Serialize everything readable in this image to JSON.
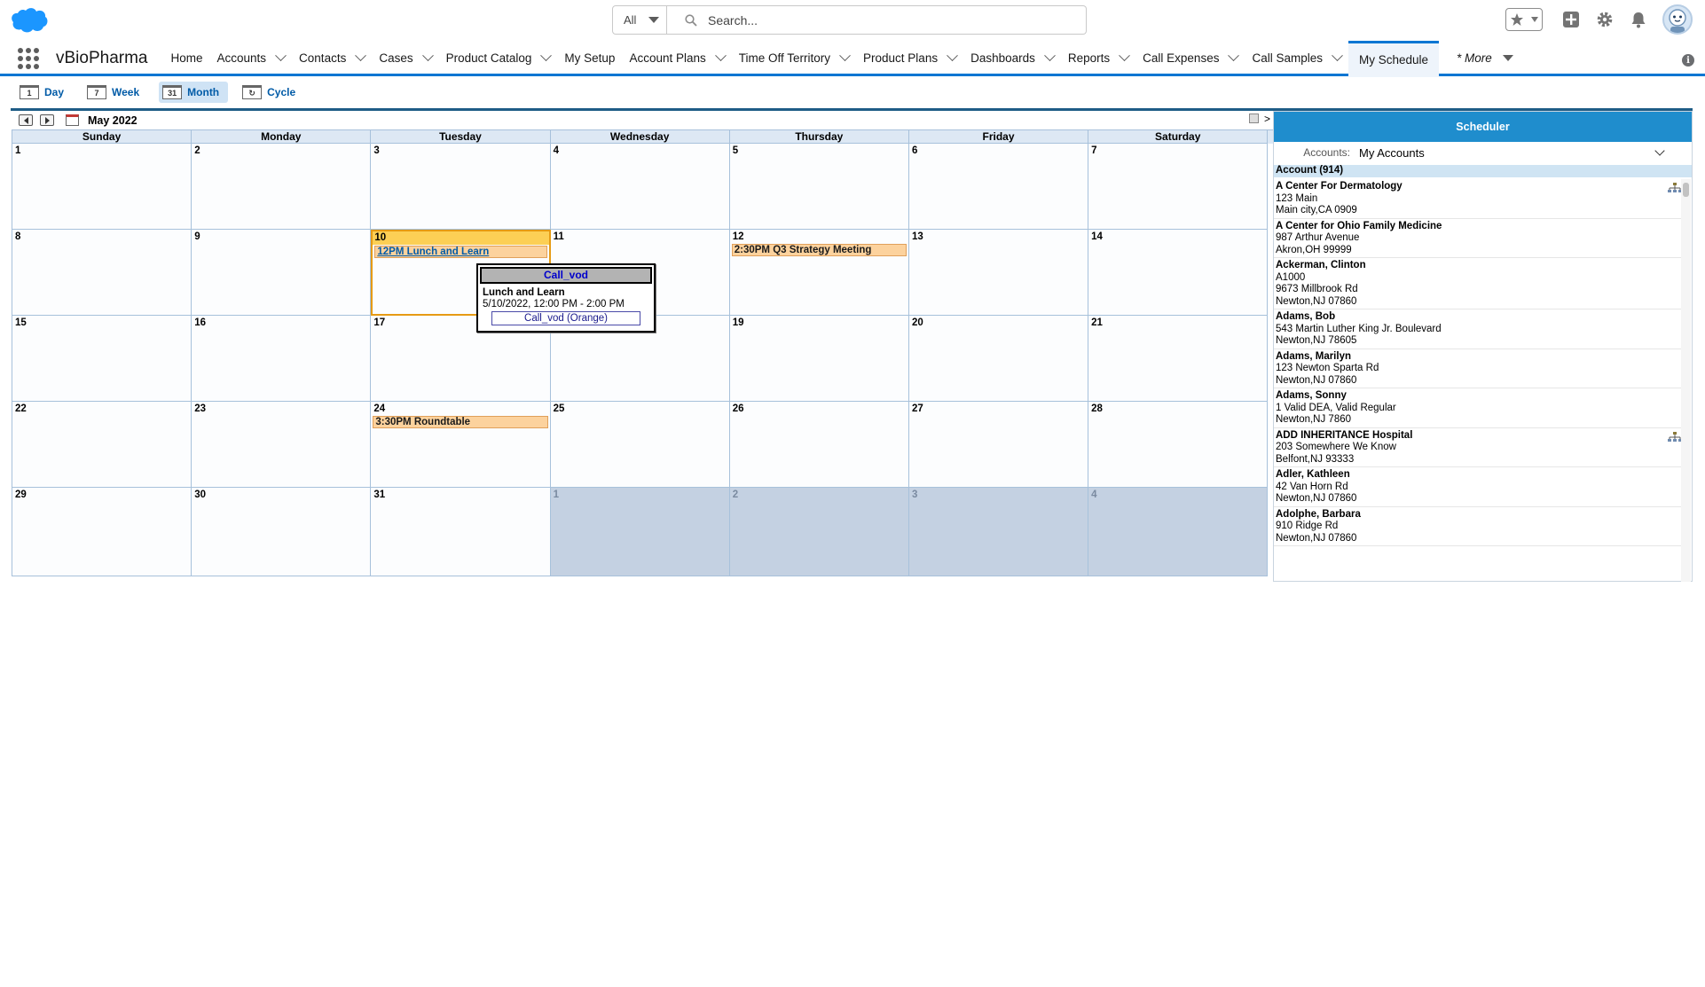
{
  "header": {
    "search_scope": "All",
    "search_placeholder": "Search..."
  },
  "nav": {
    "app_name": "vBioPharma",
    "items": [
      {
        "label": "Home",
        "chevron": false
      },
      {
        "label": "Accounts",
        "chevron": true
      },
      {
        "label": "Contacts",
        "chevron": true
      },
      {
        "label": "Cases",
        "chevron": true
      },
      {
        "label": "Product Catalog",
        "chevron": true
      },
      {
        "label": "My Setup",
        "chevron": false
      },
      {
        "label": "Account Plans",
        "chevron": true
      },
      {
        "label": "Time Off Territory",
        "chevron": true
      },
      {
        "label": "Product Plans",
        "chevron": true
      },
      {
        "label": "Dashboards",
        "chevron": true
      },
      {
        "label": "Reports",
        "chevron": true
      },
      {
        "label": "Call Expenses",
        "chevron": true
      },
      {
        "label": "Call Samples",
        "chevron": true
      }
    ],
    "active_item": "My Schedule",
    "more_label": "* More"
  },
  "views": [
    {
      "icon": "1",
      "label": "Day",
      "active": false
    },
    {
      "icon": "7",
      "label": "Week",
      "active": false
    },
    {
      "icon": "31",
      "label": "Month",
      "active": true
    },
    {
      "icon": "↻",
      "label": "Cycle",
      "active": false
    }
  ],
  "calendar": {
    "month_title": "May 2022",
    "next_label": ">",
    "days_of_week": [
      "Sunday",
      "Monday",
      "Tuesday",
      "Wednesday",
      "Thursday",
      "Friday",
      "Saturday"
    ],
    "weeks": [
      [
        {
          "d": "1"
        },
        {
          "d": "2"
        },
        {
          "d": "3"
        },
        {
          "d": "4"
        },
        {
          "d": "5"
        },
        {
          "d": "6"
        },
        {
          "d": "7"
        }
      ],
      [
        {
          "d": "8"
        },
        {
          "d": "9"
        },
        {
          "d": "10",
          "today": true,
          "events": [
            {
              "text": "12PM Lunch and Learn",
              "link": true
            }
          ]
        },
        {
          "d": "11"
        },
        {
          "d": "12",
          "events": [
            {
              "text": "2:30PM Q3 Strategy Meeting",
              "link": false
            }
          ]
        },
        {
          "d": "13"
        },
        {
          "d": "14"
        }
      ],
      [
        {
          "d": "15"
        },
        {
          "d": "16"
        },
        {
          "d": "17"
        },
        {
          "d": "18"
        },
        {
          "d": "19"
        },
        {
          "d": "20"
        },
        {
          "d": "21"
        }
      ],
      [
        {
          "d": "22"
        },
        {
          "d": "23"
        },
        {
          "d": "24",
          "events": [
            {
              "text": "3:30PM Roundtable",
              "link": false
            }
          ]
        },
        {
          "d": "25"
        },
        {
          "d": "26"
        },
        {
          "d": "27"
        },
        {
          "d": "28"
        }
      ],
      [
        {
          "d": "29"
        },
        {
          "d": "30"
        },
        {
          "d": "31"
        },
        {
          "d": "1",
          "other": true
        },
        {
          "d": "2",
          "other": true
        },
        {
          "d": "3",
          "other": true
        },
        {
          "d": "4",
          "other": true
        }
      ]
    ]
  },
  "popup": {
    "title": "Call_vod",
    "name": "Lunch and Learn",
    "time": "5/10/2022, 12:00 PM - 2:00 PM",
    "button": "Call_vod (Orange)"
  },
  "scheduler": {
    "title": "Scheduler",
    "filter_label": "Accounts:",
    "filter_value": "My Accounts",
    "list_header": "Account (914)",
    "accounts": [
      {
        "name": "A Center For Dermatology",
        "lines": [
          "123 Main",
          "Main city,CA 0909"
        ],
        "hierarchy": true
      },
      {
        "name": "A Center for Ohio Family Medicine",
        "lines": [
          "987 Arthur Avenue",
          "Akron,OH 99999"
        ],
        "hierarchy": false
      },
      {
        "name": "Ackerman, Clinton",
        "lines": [
          "A1000",
          "9673 Millbrook Rd",
          "Newton,NJ 07860"
        ],
        "hierarchy": false
      },
      {
        "name": "Adams, Bob",
        "lines": [
          "543 Martin Luther King Jr. Boulevard",
          "Newton,NJ 78605"
        ],
        "hierarchy": false
      },
      {
        "name": "Adams, Marilyn",
        "lines": [
          "123 Newton Sparta Rd",
          "Newton,NJ 07860"
        ],
        "hierarchy": false
      },
      {
        "name": "Adams, Sonny",
        "lines": [
          "1 Valid DEA, Valid Regular",
          "Newton,NJ 7860"
        ],
        "hierarchy": false
      },
      {
        "name": "ADD INHERITANCE Hospital",
        "lines": [
          "203 Somewhere We Know",
          "Belfont,NJ 93333"
        ],
        "hierarchy": true
      },
      {
        "name": "Adler, Kathleen",
        "lines": [
          "42 Van Horn Rd",
          "Newton,NJ 07860"
        ],
        "hierarchy": false
      },
      {
        "name": "Adolphe, Barbara",
        "lines": [
          "910 Ridge Rd",
          "Newton,NJ 07860"
        ],
        "hierarchy": false
      }
    ]
  }
}
